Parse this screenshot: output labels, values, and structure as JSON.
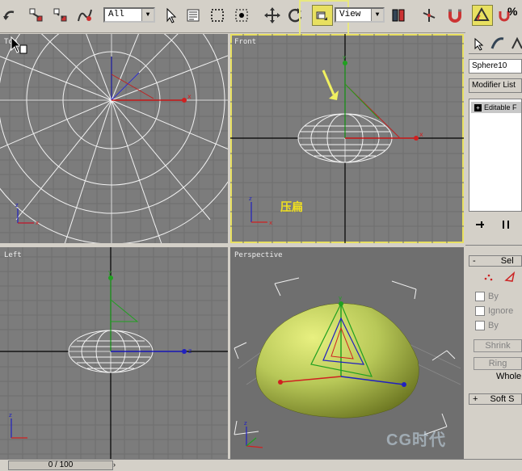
{
  "toolbar": {
    "selection_filter": "All",
    "reference_coord": "View",
    "percent_label": "%"
  },
  "viewports": {
    "top": {
      "label": "Top"
    },
    "front": {
      "label": "Front",
      "caption": "压扁"
    },
    "left": {
      "label": "Left"
    },
    "perspective": {
      "label": "Perspective"
    }
  },
  "axes": {
    "x": "x",
    "y": "y",
    "z": "z"
  },
  "command_panel": {
    "object_name": "Sphere10",
    "modifier_list": "Modifier List",
    "stack_item": "Editable F",
    "selection_rollout": "Sel",
    "by_vertex": "By",
    "ignore_backfacing": "Ignore",
    "by_angle": "By",
    "shrink": "Shrink",
    "ring": "Ring",
    "whole": "Whole",
    "soft_selection": "Soft S",
    "minus": "-",
    "plus": "+"
  },
  "timeline": {
    "frame": "0 / 100"
  },
  "watermark": {
    "text": "CG时代"
  },
  "colors": {
    "accent": "#e8e060",
    "viewport_bg": "#7c7c7c",
    "sphere": "#b8c858"
  }
}
